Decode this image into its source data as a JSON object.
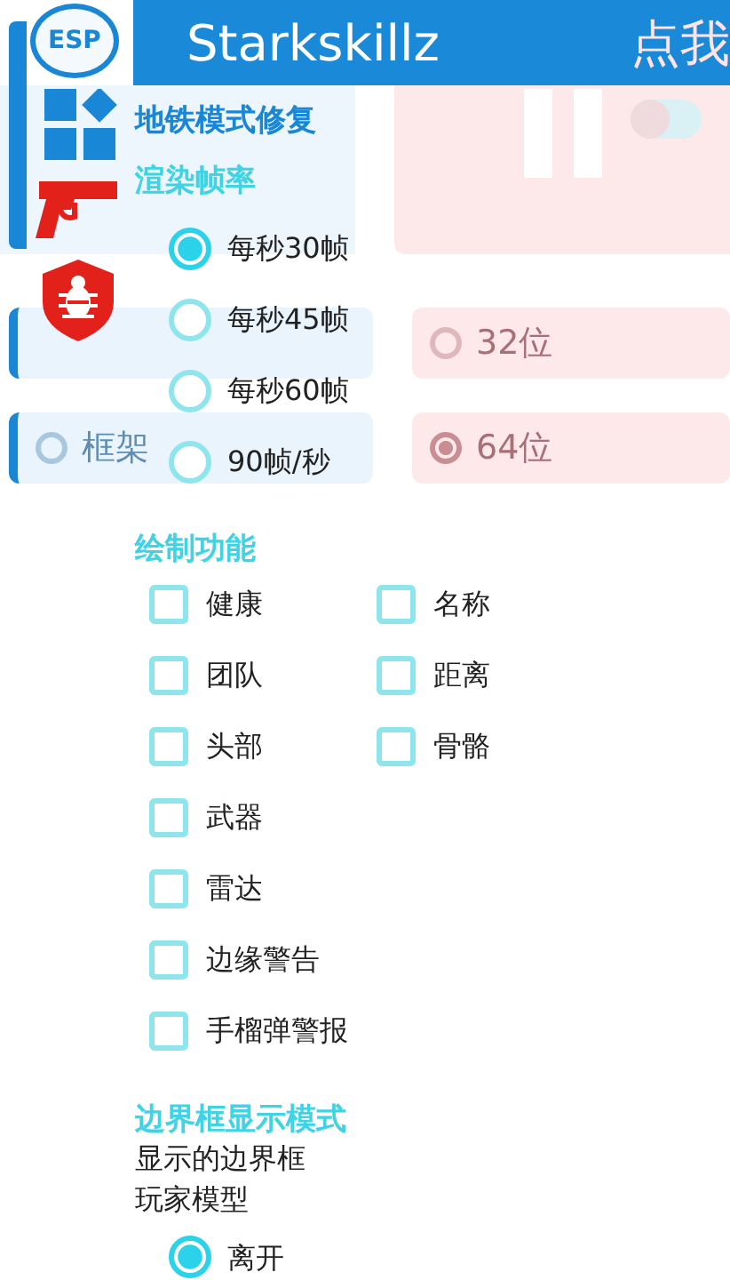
{
  "header": {
    "logo": "ESP",
    "title": "Starkskillz"
  },
  "background": {
    "button": "点我",
    "switch": {
      "on": false
    },
    "rows": [
      {
        "left": {},
        "right": {
          "label": "32位",
          "selected": false
        }
      },
      {
        "left": {
          "label": "框架",
          "selected": false
        },
        "right": {
          "label": "64位",
          "selected": true
        }
      }
    ]
  },
  "menu": {
    "toggle_label": "地铁模式修复",
    "frame_rate": {
      "title": "渲染帧率",
      "options": [
        {
          "label": "每秒30帧",
          "selected": true
        },
        {
          "label": "每秒45帧",
          "selected": false
        },
        {
          "label": "每秒60帧",
          "selected": false
        },
        {
          "label": "90帧/秒",
          "selected": false
        }
      ]
    },
    "draw": {
      "title": "绘制功能",
      "items": [
        {
          "label": "健康",
          "checked": false
        },
        {
          "label": "名称",
          "checked": false
        },
        {
          "label": "团队",
          "checked": false
        },
        {
          "label": "距离",
          "checked": false
        },
        {
          "label": "头部",
          "checked": false
        },
        {
          "label": "骨骼",
          "checked": false
        },
        {
          "label": "武器",
          "checked": false
        },
        {
          "label": "雷达",
          "checked": false
        },
        {
          "label": "边缘警告",
          "checked": false
        },
        {
          "label": "手榴弹警报",
          "checked": false
        }
      ]
    },
    "box_mode": {
      "title": "边界框显示模式",
      "lines": [
        "显示的边界框",
        "玩家模型"
      ],
      "options": [
        {
          "label": "离开",
          "selected": true
        }
      ]
    }
  }
}
